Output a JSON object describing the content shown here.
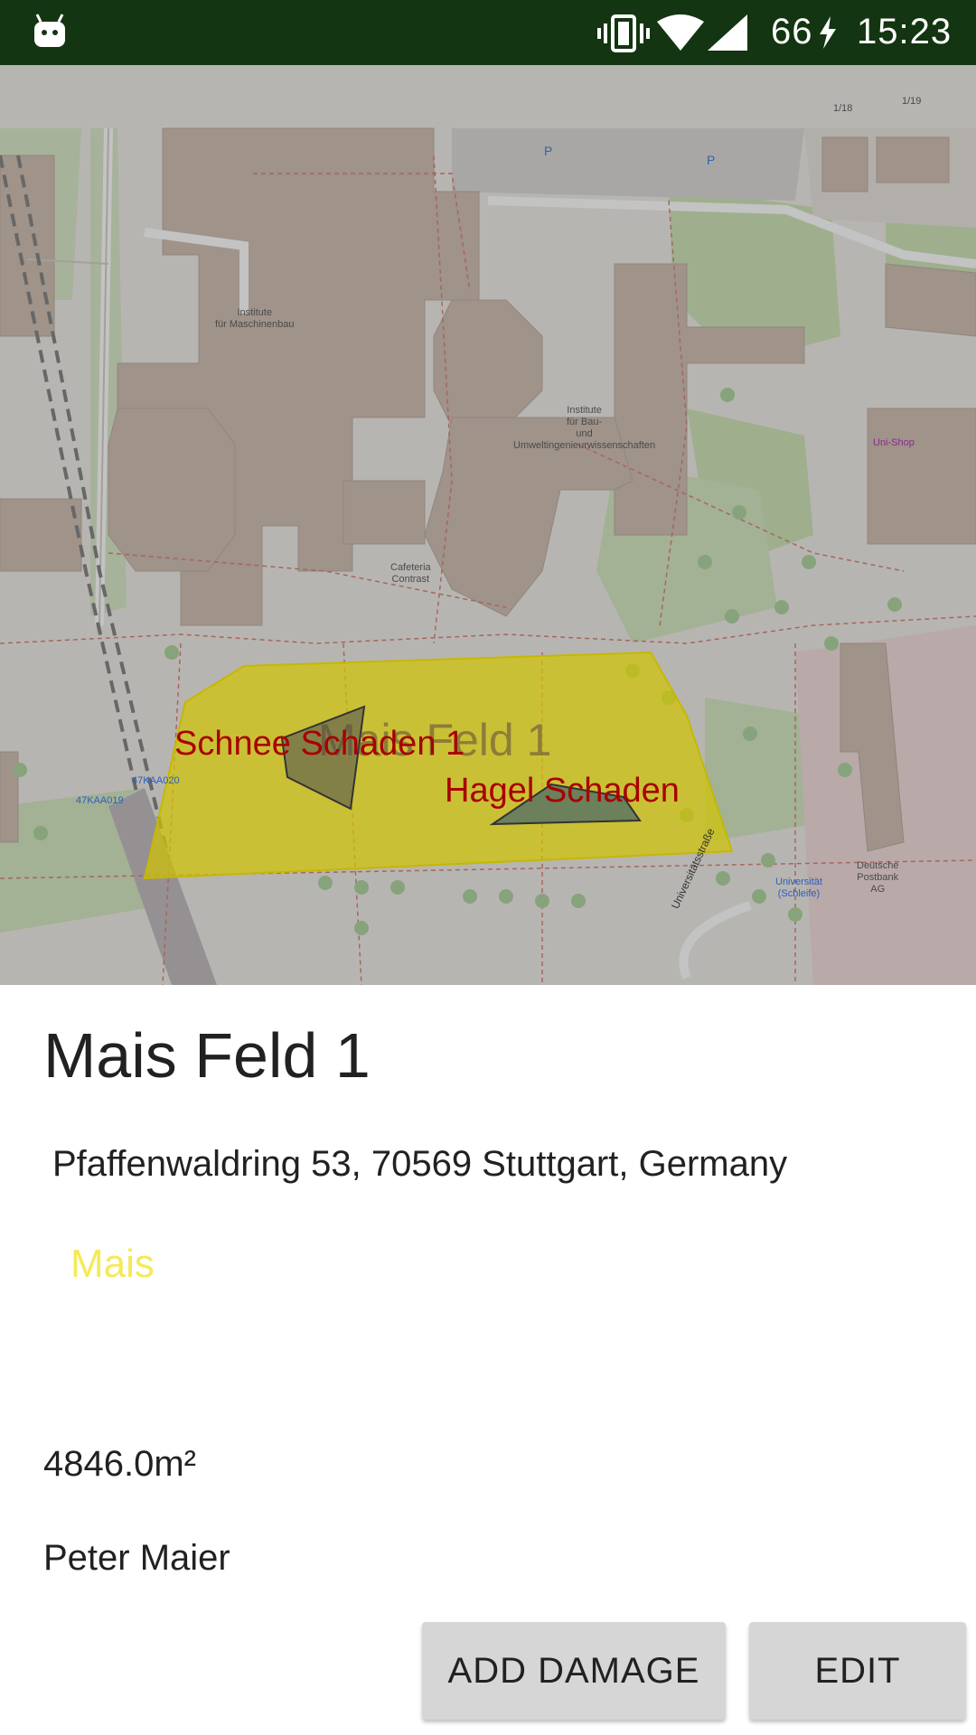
{
  "status_bar": {
    "battery": "66",
    "time": "15:23"
  },
  "map": {
    "field_label": "Mais Feld 1",
    "damages": [
      {
        "name": "Schnee Schaden 1"
      },
      {
        "name": "Hagel Schaden"
      }
    ],
    "pois": {
      "maschinenbau": "Institute\nfür Maschinenbau",
      "bau": "Institute\nfür Bau-\nund\nUmweltingenieurwissenschaften",
      "cafeteria": "Cafeteria\nContrast",
      "uni_shop": "Uni-Shop",
      "postbank": "Deutsche\nPostbank\nAG",
      "universitaet": "Universität\n(Schleife)",
      "kaa019": "47KAA019",
      "kaa020": "47KAA020",
      "num_118": "1/18",
      "num_119": "1/19",
      "street": "Universitätsstraße"
    },
    "colors": {
      "field_fill": "#d1c400",
      "damage_fill": "#6b6b4e",
      "damage_label": "#a80000"
    }
  },
  "details": {
    "title": "Mais Feld 1",
    "address": "Pfaffenwaldring 53, 70569 Stuttgart, Germany",
    "crop": "Mais",
    "area": "4846.0m²",
    "owner": "Peter Maier"
  },
  "actions": {
    "add_damage": "ADD DAMAGE",
    "edit": "EDIT"
  }
}
